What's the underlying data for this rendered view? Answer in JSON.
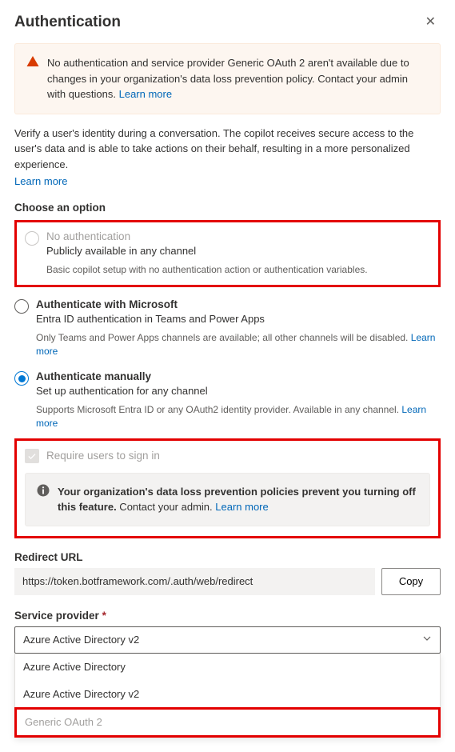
{
  "header": {
    "title": "Authentication"
  },
  "banner": {
    "text": "No authentication and service provider Generic OAuth 2 aren't available due to changes in your organization's data loss prevention policy. Contact your admin with questions. ",
    "learn_more": "Learn more"
  },
  "intro": {
    "text": "Verify a user's identity during a conversation. The copilot receives secure access to the user's data and is able to take actions on their behalf, resulting in a more personalized experience.",
    "learn_more": "Learn more"
  },
  "choose_label": "Choose an option",
  "options": {
    "none": {
      "title": "No authentication",
      "sub": "Publicly available in any channel",
      "note": "Basic copilot setup with no authentication action or authentication variables."
    },
    "ms": {
      "title": "Authenticate with Microsoft",
      "sub": "Entra ID authentication in Teams and Power Apps",
      "note": "Only Teams and Power Apps channels are available; all other channels will be disabled. ",
      "learn_more": "Learn more"
    },
    "manual": {
      "title": "Authenticate manually",
      "sub": "Set up authentication for any channel",
      "note": "Supports Microsoft Entra ID or any OAuth2 identity provider. Available in any channel. ",
      "learn_more": "Learn more"
    }
  },
  "require_signin": {
    "label": "Require users to sign in",
    "info_strong": "Your organization's data loss prevention policies prevent you turning off this feature.",
    "info_rest": " Contact your admin. ",
    "learn_more": "Learn more"
  },
  "redirect": {
    "label": "Redirect URL",
    "value": "https://token.botframework.com/.auth/web/redirect",
    "copy": "Copy"
  },
  "provider": {
    "label": "Service provider",
    "selected": "Azure Active Directory v2",
    "options": [
      "Azure Active Directory",
      "Azure Active Directory v2",
      "Generic OAuth 2"
    ]
  }
}
